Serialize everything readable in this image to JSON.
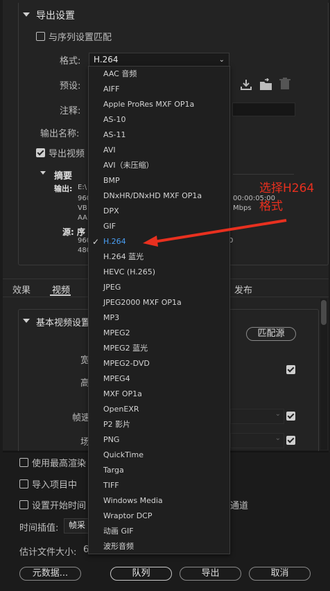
{
  "export_settings": {
    "section_title": "导出设置",
    "match_sequence_label": "与序列设置匹配",
    "format_label": "格式:",
    "format_value": "H.264",
    "preset_label": "预设:",
    "comment_label": "注释:",
    "output_name_label": "输出名称:",
    "export_video_label": "导出视频",
    "summary_title": "摘要",
    "output_label": "输出:",
    "output_lines": [
      "E:\\",
      "960",
      "VB",
      "AA"
    ],
    "output_right": [
      "00:00:05:00",
      "Mbps"
    ],
    "source_label": "源: 序",
    "source_lines": [
      "960",
      "480"
    ],
    "source_right": "0"
  },
  "tabs": [
    "效果",
    "视频",
    "发布"
  ],
  "video_settings": {
    "section_title": "基本视频设置",
    "match_source_button": "匹配源",
    "width_label": "宽",
    "height_label": "高",
    "frame_rate_label": "帧速",
    "field_label": "场"
  },
  "bottom": {
    "max_render_label": "使用最高渲染",
    "import_project_label": "导入项目中",
    "set_start_label": "设置开始时间",
    "channel_label": "通道",
    "time_interp_label": "时间插值:",
    "time_interp_value": "帧采",
    "est_size_label": "估计文件大小:",
    "est_size_value": "6",
    "metadata_button": "元数据...",
    "queue_button": "队列",
    "export_button": "导出",
    "cancel_button": "取消"
  },
  "format_dropdown": {
    "selected": "H.264",
    "options": [
      "AAC 音频",
      "AIFF",
      "Apple ProRes MXF OP1a",
      "AS-10",
      "AS-11",
      "AVI",
      "AVI（未压缩）",
      "BMP",
      "DNxHR/DNxHD MXF OP1a",
      "DPX",
      "GIF",
      "H.264",
      "H.264 蓝光",
      "HEVC (H.265)",
      "JPEG",
      "JPEG2000 MXF OP1a",
      "MP3",
      "MPEG2",
      "MPEG2 蓝光",
      "MPEG2-DVD",
      "MPEG4",
      "MXF OP1a",
      "OpenEXR",
      "P2 影片",
      "PNG",
      "QuickTime",
      "Targa",
      "TIFF",
      "Windows Media",
      "Wraptor DCP",
      "动画 GIF",
      "波形音频"
    ]
  },
  "annotation": {
    "line1": "选择H264",
    "line2": "格式",
    "color": "#e8301f"
  }
}
